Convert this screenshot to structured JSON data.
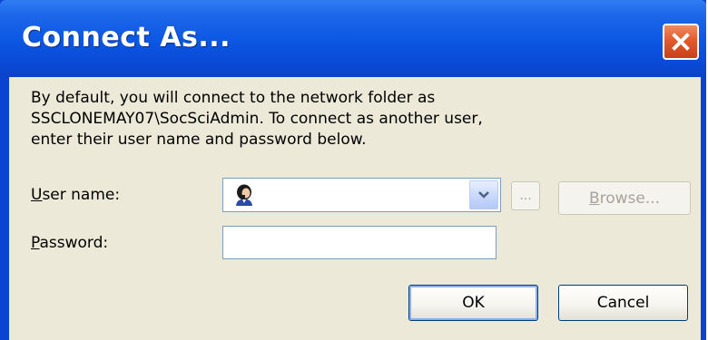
{
  "window": {
    "title": "Connect As...",
    "close_icon": "close-icon"
  },
  "description": {
    "line1": "By default, you will connect to the network folder as",
    "line2": "SSCLONEMAY07\\SocSciAdmin. To connect as another user,",
    "line3": "enter their user name and password below."
  },
  "fields": {
    "username_label_mnemonic": "U",
    "username_label_rest": "ser name:",
    "username_value": "",
    "username_icon": "user-icon",
    "password_label_mnemonic": "P",
    "password_label_rest": "assword:",
    "password_value": ""
  },
  "buttons": {
    "ellipsis_label": "...",
    "browse_mnemonic": "B",
    "browse_rest": "rowse...",
    "ok_label": "OK",
    "cancel_label": "Cancel"
  },
  "colors": {
    "titlebar": "#0b56e3",
    "client_background": "#ece9d8",
    "close_button": "#e35a2d",
    "field_border": "#7f9db9",
    "disabled_text": "#a6a39a"
  }
}
